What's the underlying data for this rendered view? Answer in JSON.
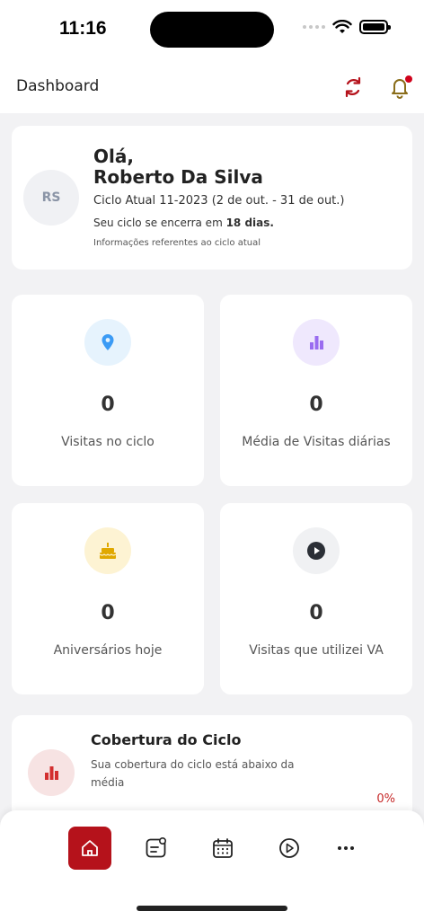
{
  "status_bar": {
    "time": "11:16"
  },
  "app_bar": {
    "title": "Dashboard"
  },
  "profile": {
    "initials": "RS",
    "greeting": "Olá,",
    "name": "Roberto Da Silva",
    "cycle": "Ciclo Atual 11-2023 (2 de out. - 31 de out.)",
    "ends_prefix": "Seu ciclo se encerra em ",
    "ends_days": "18 dias.",
    "info": "Informações referentes ao ciclo atual"
  },
  "stats": [
    {
      "value": "0",
      "label": "Visitas no ciclo",
      "icon": "location-pin-icon",
      "color": "#3b9bf5",
      "bg": "#e6f3fd"
    },
    {
      "value": "0",
      "label": "Média de Visitas diárias",
      "icon": "bar-chart-icon",
      "color": "#9a6cf0",
      "bg": "#efe8fd"
    },
    {
      "value": "0",
      "label": "Aniversários hoje",
      "icon": "cake-icon",
      "color": "#e0a800",
      "bg": "#fdf3d3"
    },
    {
      "value": "0",
      "label": "Visitas que utilizei  VA",
      "icon": "play-circle-icon",
      "color": "#2b2f36",
      "bg": "#f0f1f3"
    }
  ],
  "coverage": {
    "title": "Cobertura do Ciclo",
    "description": "Sua cobertura do ciclo está abaixo da média",
    "percent": "0%",
    "icon": "bar-chart-icon",
    "color": "#d32f2f"
  },
  "tabbar": {
    "tabs": [
      {
        "icon": "home-icon",
        "active": true
      },
      {
        "icon": "notes-icon",
        "active": false
      },
      {
        "icon": "calendar-icon",
        "active": false
      },
      {
        "icon": "play-icon",
        "active": false
      },
      {
        "icon": "more-icon",
        "active": false
      }
    ]
  },
  "colors": {
    "accent": "#b5121b",
    "background": "#f2f2f4"
  }
}
